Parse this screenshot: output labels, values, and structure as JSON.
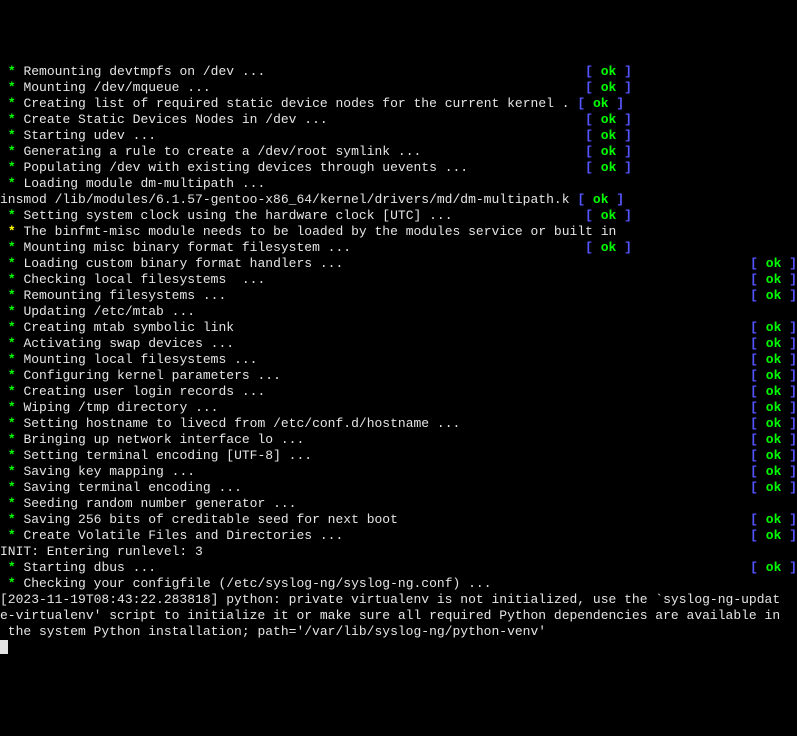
{
  "status": {
    "ok_open": "[ ",
    "ok_text": "ok",
    "ok_close": " ]"
  },
  "lines": [
    {
      "star": "green",
      "text": "Remounting devtmpfs on /dev ...",
      "status": true,
      "col": 1
    },
    {
      "star": "green",
      "text": "Mounting /dev/mqueue ...",
      "status": true,
      "col": 1
    },
    {
      "star": "green",
      "text": "Creating list of required static device nodes for the current kernel .",
      "status": true,
      "col": 1,
      "statusInline": true
    },
    {
      "star": "green",
      "text": "Create Static Devices Nodes in /dev ...",
      "status": true,
      "col": 1
    },
    {
      "star": "green",
      "text": "Starting udev ...",
      "status": true,
      "col": 1
    },
    {
      "star": "green",
      "text": "Generating a rule to create a /dev/root symlink ...",
      "status": true,
      "col": 1
    },
    {
      "star": "green",
      "text": "Populating /dev with existing devices through uevents ...",
      "status": true,
      "col": 1
    },
    {
      "star": "green",
      "text": "Loading module dm-multipath ...",
      "status": false,
      "col": 1
    },
    {
      "raw": "insmod /lib/modules/6.1.57-gentoo-x86_64/kernel/drivers/md/dm-multipath.k",
      "status": true,
      "col": 1,
      "statusInline": true,
      "rawLine": true
    },
    {
      "star": "green",
      "text": "Setting system clock using the hardware clock [UTC] ...",
      "status": true,
      "col": 1
    },
    {
      "star": "yellow",
      "text": "The binfmt-misc module needs to be loaded by the modules service or built in",
      "status": false,
      "col": 1
    },
    {
      "star": "green",
      "text": "Mounting misc binary format filesystem ...",
      "status": true,
      "col": 1
    },
    {
      "star": "green",
      "text": "Loading custom binary format handlers ...",
      "status": true,
      "col": 2
    },
    {
      "star": "green",
      "text": "Checking local filesystems  ...",
      "status": true,
      "col": 2
    },
    {
      "star": "green",
      "text": "Remounting filesystems ...",
      "status": true,
      "col": 2
    },
    {
      "star": "green",
      "text": "Updating /etc/mtab ...",
      "status": false,
      "col": 2
    },
    {
      "star": "green",
      "text": "Creating mtab symbolic link",
      "status": true,
      "col": 2
    },
    {
      "star": "green",
      "text": "Activating swap devices ...",
      "status": true,
      "col": 2
    },
    {
      "star": "green",
      "text": "Mounting local filesystems ...",
      "status": true,
      "col": 2
    },
    {
      "star": "green",
      "text": "Configuring kernel parameters ...",
      "status": true,
      "col": 2
    },
    {
      "star": "green",
      "text": "Creating user login records ...",
      "status": true,
      "col": 2
    },
    {
      "star": "green",
      "text": "Wiping /tmp directory ...",
      "status": true,
      "col": 2
    },
    {
      "star": "green",
      "text": "Setting hostname to livecd from /etc/conf.d/hostname ...",
      "status": true,
      "col": 2
    },
    {
      "star": "green",
      "text": "Bringing up network interface lo ...",
      "status": true,
      "col": 2
    },
    {
      "star": "green",
      "text": "Setting terminal encoding [UTF-8] ...",
      "status": true,
      "col": 2
    },
    {
      "star": "green",
      "text": "Saving key mapping ...",
      "status": true,
      "col": 2
    },
    {
      "star": "green",
      "text": "Saving terminal encoding ...",
      "status": true,
      "col": 2
    },
    {
      "star": "green",
      "text": "Seeding random number generator ...",
      "status": false,
      "col": 2
    },
    {
      "star": "green",
      "text": "Saving 256 bits of creditable seed for next boot",
      "status": true,
      "col": 2
    },
    {
      "star": "green",
      "text": "Create Volatile Files and Directories ...",
      "status": true,
      "col": 2
    },
    {
      "raw": "INIT: Entering runlevel: 3",
      "rawLine": true
    },
    {
      "star": "green",
      "text": "Starting dbus ...",
      "status": true,
      "col": 2
    },
    {
      "star": "green",
      "text": "Checking your configfile (/etc/syslog-ng/syslog-ng.conf) ...",
      "status": false,
      "col": 2
    }
  ],
  "wrap": [
    "[2023-11-19T08:43:22.283818] python: private virtualenv is not initialized, use the `syslog-ng-updat",
    "e-virtualenv' script to initialize it or make sure all required Python dependencies are available in",
    " the system Python installation; path='/var/lib/syslog-ng/python-venv'"
  ]
}
